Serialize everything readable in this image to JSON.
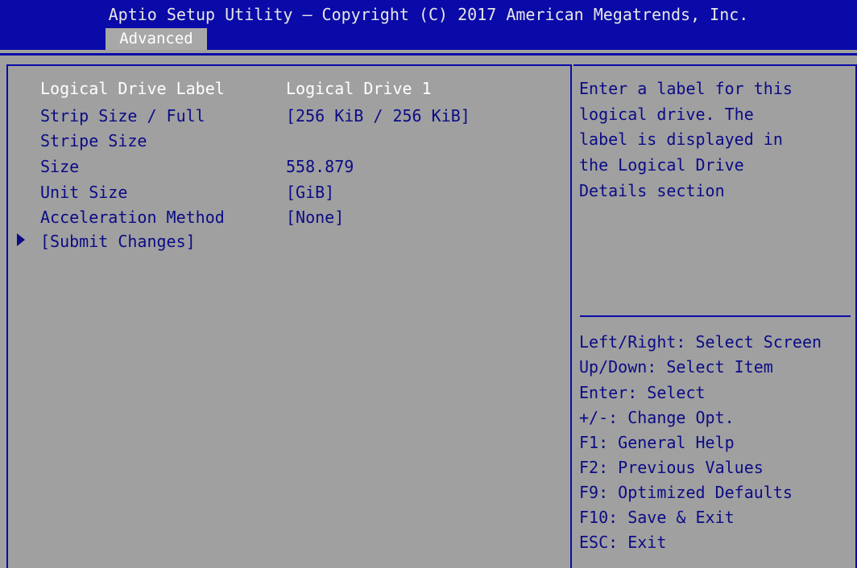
{
  "header": {
    "title": "Aptio Setup Utility – Copyright (C) 2017 American Megatrends, Inc.",
    "tabs": [
      {
        "label": "Advanced",
        "active": true
      }
    ]
  },
  "settings": [
    {
      "label": "Logical Drive Label",
      "value": "Logical Drive 1",
      "selected": true
    },
    {
      "label": "Strip Size / Full",
      "value": "[256 KiB / 256 KiB]"
    },
    {
      "label": "Stripe Size",
      "value": ""
    },
    {
      "label": "Size",
      "value": "558.879"
    },
    {
      "label": "Unit Size",
      "value": "[GiB]"
    },
    {
      "label": "Acceleration Method",
      "value": "[None]"
    },
    {
      "label": "[Submit Changes]",
      "value": "",
      "submenu": true
    }
  ],
  "help": {
    "lines": [
      "Enter a label for this",
      "logical drive. The",
      "label is displayed in",
      "the Logical Drive",
      "Details section"
    ]
  },
  "keys": [
    "Left/Right: Select Screen",
    "Up/Down: Select Item",
    "Enter: Select",
    "+/-: Change Opt.",
    "F1: General Help",
    "F2: Previous Values",
    "F9: Optimized Defaults",
    "F10: Save & Exit",
    "ESC: Exit"
  ],
  "colors": {
    "header_bg": "#0a0aa8",
    "body_bg": "#a0a0a0",
    "text": "#0b0b86",
    "selected_text": "#ffffff"
  }
}
